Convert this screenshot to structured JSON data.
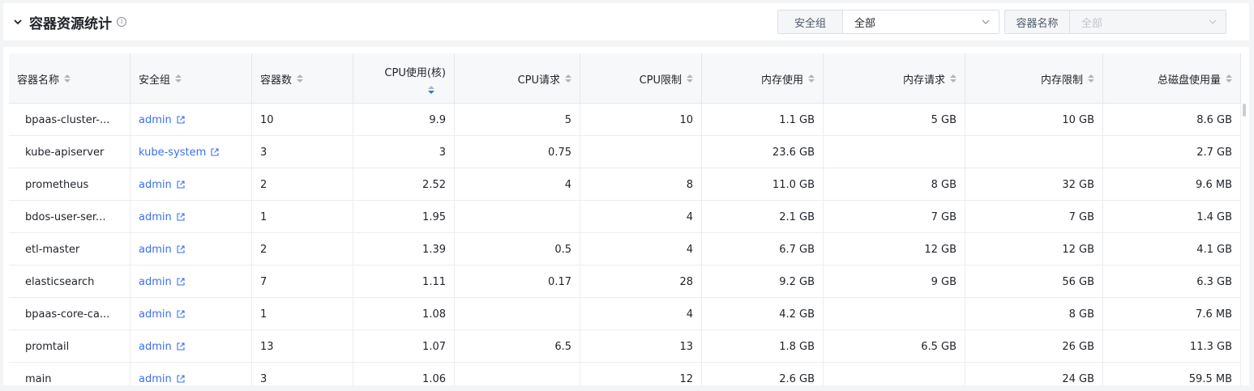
{
  "header": {
    "title": "容器资源统计",
    "info_icon": "info-icon"
  },
  "filters": {
    "security_group": {
      "label": "安全组",
      "value": "全部"
    },
    "container_name": {
      "label": "容器名称",
      "placeholder": "全部"
    }
  },
  "table": {
    "columns": [
      "容器名称",
      "安全组",
      "容器数",
      "CPU使用(核)",
      "CPU请求",
      "CPU限制",
      "内存使用",
      "内存请求",
      "内存限制",
      "总磁盘使用量"
    ],
    "rows": [
      {
        "name": "bpaas-cluster-...",
        "group": "admin",
        "count": "10",
        "cpu_use": "9.9",
        "cpu_req": "5",
        "cpu_lim": "10",
        "mem_use": "1.1 GB",
        "mem_req": "5 GB",
        "mem_lim": "10 GB",
        "disk": "8.6 GB"
      },
      {
        "name": "kube-apiserver",
        "group": "kube-system",
        "count": "3",
        "cpu_use": "3",
        "cpu_req": "0.75",
        "cpu_lim": "",
        "mem_use": "23.6 GB",
        "mem_req": "",
        "mem_lim": "",
        "disk": "2.7 GB"
      },
      {
        "name": "prometheus",
        "group": "admin",
        "count": "2",
        "cpu_use": "2.52",
        "cpu_req": "4",
        "cpu_lim": "8",
        "mem_use": "11.0 GB",
        "mem_req": "8 GB",
        "mem_lim": "32 GB",
        "disk": "9.6 MB"
      },
      {
        "name": "bdos-user-ser...",
        "group": "admin",
        "count": "1",
        "cpu_use": "1.95",
        "cpu_req": "",
        "cpu_lim": "4",
        "mem_use": "2.1 GB",
        "mem_req": "7 GB",
        "mem_lim": "7 GB",
        "disk": "1.4 GB"
      },
      {
        "name": "etl-master",
        "group": "admin",
        "count": "2",
        "cpu_use": "1.39",
        "cpu_req": "0.5",
        "cpu_lim": "4",
        "mem_use": "6.7 GB",
        "mem_req": "12 GB",
        "mem_lim": "12 GB",
        "disk": "4.1 GB"
      },
      {
        "name": "elasticsearch",
        "group": "admin",
        "count": "7",
        "cpu_use": "1.11",
        "cpu_req": "0.17",
        "cpu_lim": "28",
        "mem_use": "9.2 GB",
        "mem_req": "9 GB",
        "mem_lim": "56 GB",
        "disk": "6.3 GB"
      },
      {
        "name": "bpaas-core-ca...",
        "group": "admin",
        "count": "1",
        "cpu_use": "1.08",
        "cpu_req": "",
        "cpu_lim": "4",
        "mem_use": "4.2 GB",
        "mem_req": "",
        "mem_lim": "8 GB",
        "disk": "7.6 MB"
      },
      {
        "name": "promtail",
        "group": "admin",
        "count": "13",
        "cpu_use": "1.07",
        "cpu_req": "6.5",
        "cpu_lim": "13",
        "mem_use": "1.8 GB",
        "mem_req": "6.5 GB",
        "mem_lim": "26 GB",
        "disk": "11.3 GB"
      },
      {
        "name": "main",
        "group": "admin",
        "count": "3",
        "cpu_use": "1.06",
        "cpu_req": "",
        "cpu_lim": "12",
        "mem_use": "2.6 GB",
        "mem_req": "",
        "mem_lim": "24 GB",
        "disk": "59.5 MB"
      }
    ]
  },
  "colors": {
    "link": "#3a6ff0",
    "sort_active": "#3a6ff0"
  }
}
